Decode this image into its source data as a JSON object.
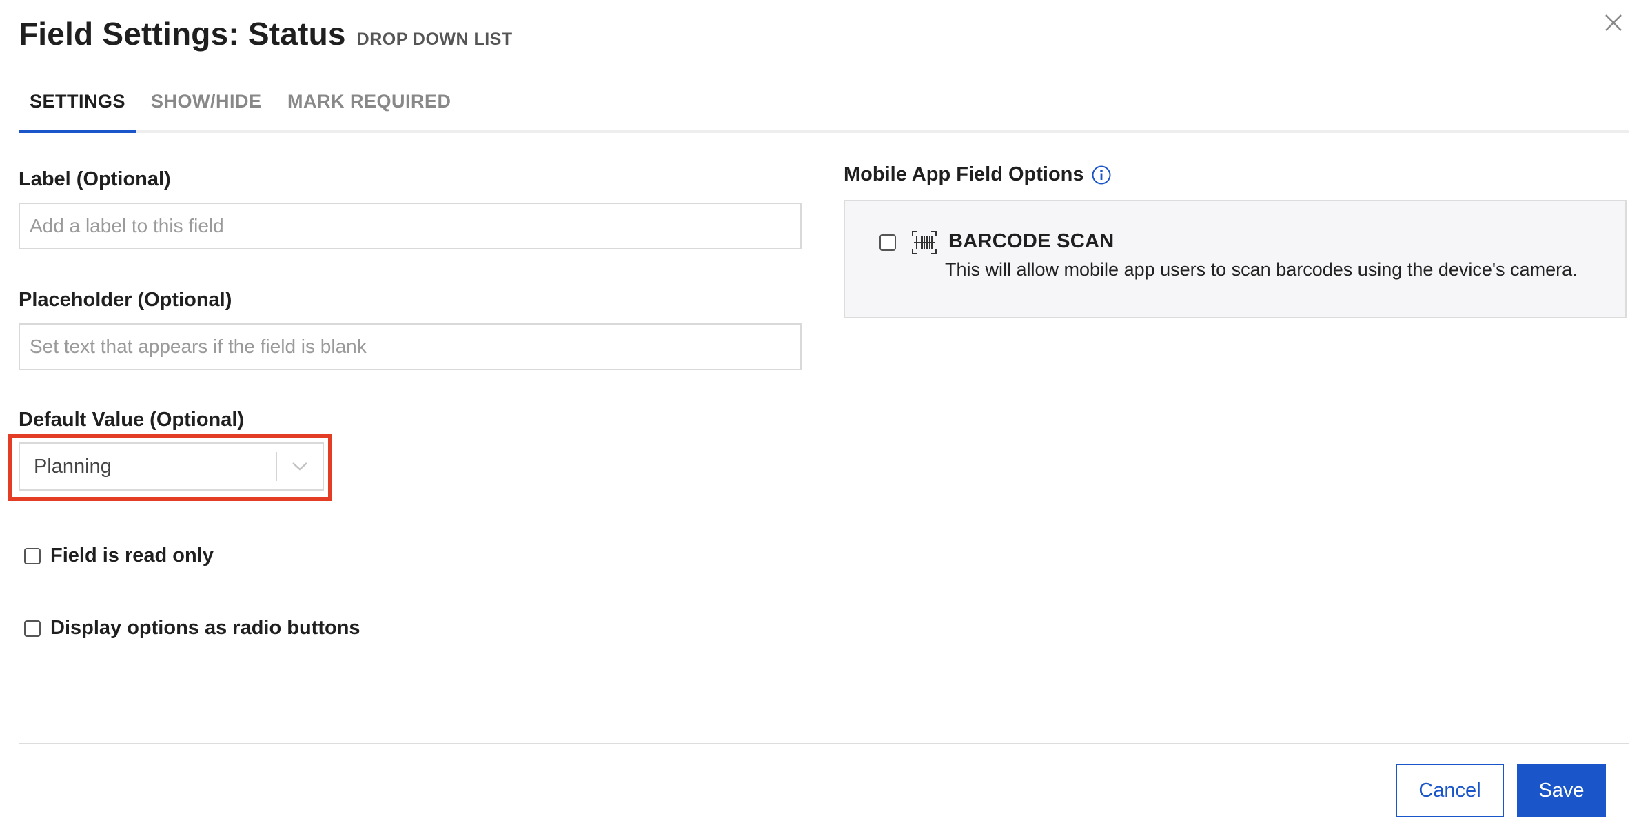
{
  "header": {
    "title": "Field Settings: Status",
    "subtitle": "DROP DOWN LIST"
  },
  "tabs": [
    {
      "label": "SETTINGS",
      "active": true
    },
    {
      "label": "SHOW/HIDE",
      "active": false
    },
    {
      "label": "MARK REQUIRED",
      "active": false
    }
  ],
  "form": {
    "label_field": {
      "label": "Label (Optional)",
      "placeholder": "Add a label to this field",
      "value": ""
    },
    "placeholder_field": {
      "label": "Placeholder (Optional)",
      "placeholder": "Set text that appears if the field is blank",
      "value": ""
    },
    "default_value": {
      "label": "Default Value (Optional)",
      "selected": "Planning"
    },
    "read_only": {
      "label": "Field is read only",
      "checked": false
    },
    "radio_buttons": {
      "label": "Display options as radio buttons",
      "checked": false
    }
  },
  "mobile_options": {
    "title": "Mobile App Field Options",
    "barcode": {
      "title": "BARCODE SCAN",
      "description": "This will allow mobile app users to scan barcodes using the device's camera.",
      "checked": false
    }
  },
  "footer": {
    "cancel_label": "Cancel",
    "save_label": "Save"
  },
  "colors": {
    "accent": "#1a56c9",
    "highlight": "#e43d26",
    "panel_bg": "#f6f6f8"
  },
  "icons": {
    "close": "close-icon",
    "info": "info-icon",
    "chevron": "chevron-down-icon",
    "barcode": "barcode-icon"
  }
}
